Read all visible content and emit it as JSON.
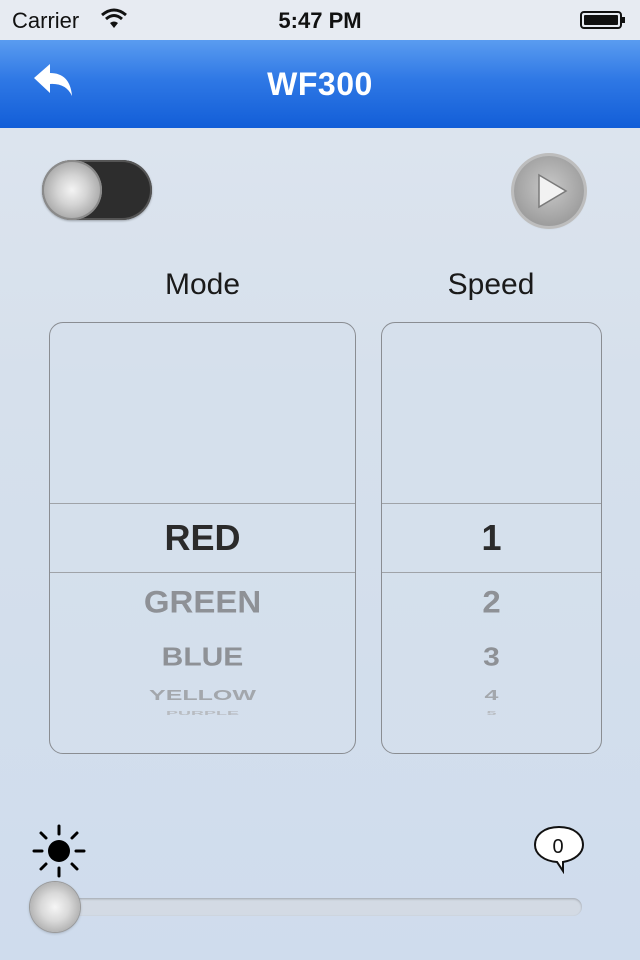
{
  "status_bar": {
    "carrier": "Carrier",
    "time": "5:47 PM"
  },
  "nav": {
    "title": "WF300",
    "back_icon": "back-arrow-icon"
  },
  "controls": {
    "power_on": false,
    "play_icon": "play-icon"
  },
  "mode": {
    "label": "Mode",
    "options": [
      "RED",
      "GREEN",
      "BLUE",
      "YELLOW",
      "PURPLE"
    ],
    "selected": "RED"
  },
  "speed": {
    "label": "Speed",
    "options": [
      "1",
      "2",
      "3",
      "4",
      "5"
    ],
    "selected": "1"
  },
  "brightness": {
    "icon": "sun-icon",
    "value": 0,
    "value_display": "0"
  }
}
